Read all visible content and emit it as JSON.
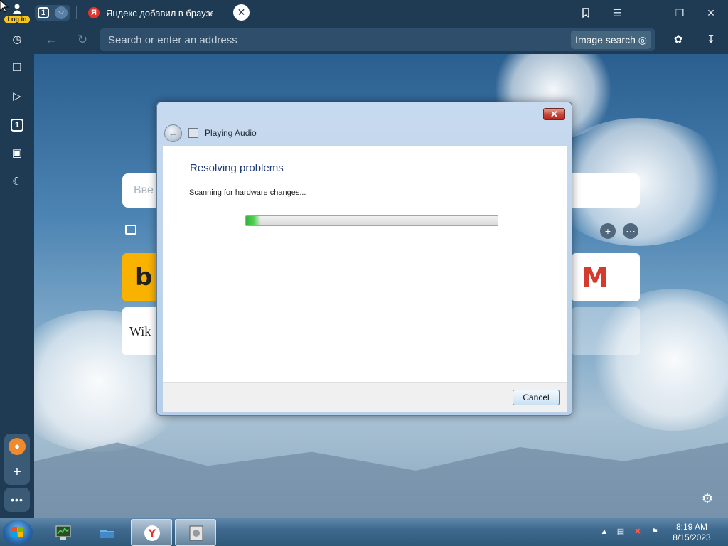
{
  "browser": {
    "login_label": "Log in",
    "tab_count": "1",
    "active_tab_title": "Яндекс добавил в браузер",
    "active_tab_favicon": "Я",
    "new_tab_icon": "close-icon",
    "address_placeholder": "Search or enter an address",
    "image_search_label": "Image search",
    "window_buttons": [
      "bookmarks-icon",
      "menu-icon",
      "minimize-icon",
      "restore-icon",
      "close-icon"
    ]
  },
  "sidebar": {
    "items": [
      "history-icon",
      "collections-icon",
      "play-icon",
      "tab-count-icon",
      "screenshot-icon",
      "night-mode-icon"
    ],
    "tab_count": "1"
  },
  "newtab": {
    "search_placeholder": "Вве",
    "tiles": [
      {
        "name": "bing",
        "label": "b",
        "color": "#f9b200"
      },
      {
        "name": "gmail",
        "label": "M",
        "color": "#d23b2e"
      },
      {
        "name": "wikipedia",
        "label": "Wik"
      }
    ]
  },
  "dialog": {
    "window_title": "Playing Audio",
    "heading": "Resolving problems",
    "status": "Scanning for hardware changes...",
    "progress_fraction": 0.06,
    "cancel_label": "Cancel"
  },
  "taskbar": {
    "time": "8:19 AM",
    "date": "8/15/2023",
    "items": [
      "task-manager",
      "file-explorer",
      "yandex-browser",
      "troubleshooter"
    ]
  }
}
